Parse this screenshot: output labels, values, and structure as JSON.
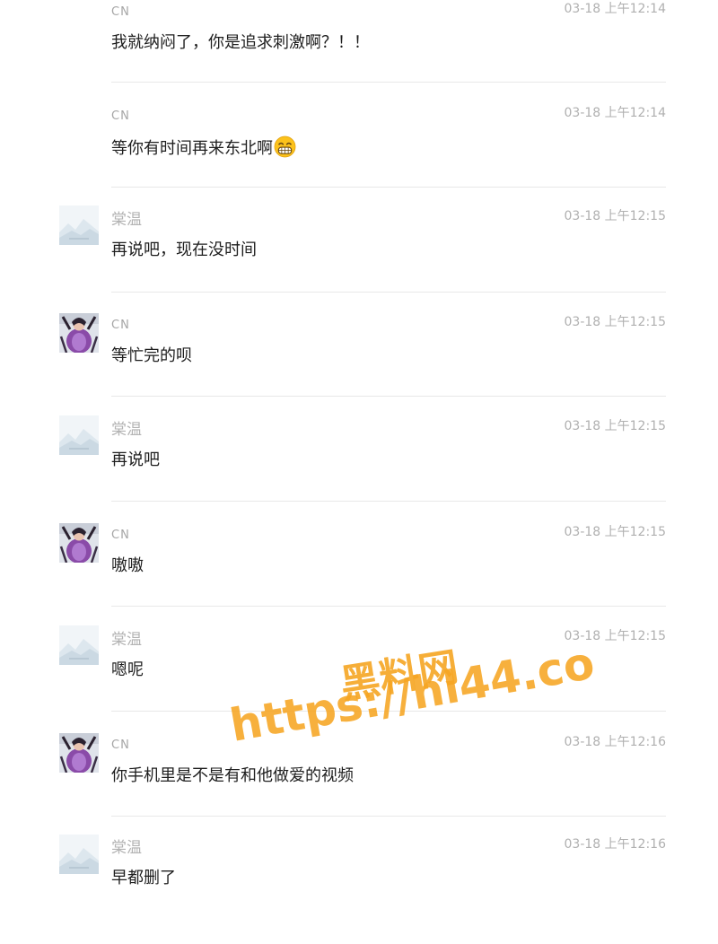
{
  "messages": [
    {
      "sender": "CN",
      "avatar": "purple-portrait-avatar",
      "show_avatar": false,
      "time": "03-18 上午12:14",
      "text": "我就纳闷了，你是追求刺激啊？！！"
    },
    {
      "sender": "CN",
      "avatar": "purple-portrait-avatar",
      "show_avatar": false,
      "time": "03-18 上午12:14",
      "text": "等你有时间再来东北啊",
      "emoji": "grinning-face-emoji"
    },
    {
      "sender": "棠温",
      "avatar": "landscape-placeholder-avatar",
      "show_avatar": true,
      "time": "03-18 上午12:15",
      "text": "再说吧，现在没时间"
    },
    {
      "sender": "CN",
      "avatar": "purple-portrait-avatar",
      "show_avatar": true,
      "time": "03-18 上午12:15",
      "text": "等忙完的呗"
    },
    {
      "sender": "棠温",
      "avatar": "landscape-placeholder-avatar",
      "show_avatar": true,
      "time": "03-18 上午12:15",
      "text": "再说吧"
    },
    {
      "sender": "CN",
      "avatar": "purple-portrait-avatar",
      "show_avatar": true,
      "time": "03-18 上午12:15",
      "text": "嗷嗷"
    },
    {
      "sender": "棠温",
      "avatar": "landscape-placeholder-avatar",
      "show_avatar": true,
      "time": "03-18 上午12:15",
      "text": "嗯呢"
    },
    {
      "sender": "CN",
      "avatar": "purple-portrait-avatar",
      "show_avatar": true,
      "time": "03-18 上午12:16",
      "text": "你手机里是不是有和他做爱的视频"
    },
    {
      "sender": "棠温",
      "avatar": "landscape-placeholder-avatar",
      "show_avatar": true,
      "time": "03-18 上午12:16",
      "text": "早都删了"
    }
  ],
  "watermark": {
    "title": "黑料网",
    "url": "https://hl44.co",
    "color": "#f6a623"
  },
  "colors": {
    "name": "#a6a6a6",
    "time": "#b0b0b0",
    "text": "#1e1e1e",
    "divider": "#e8e8e8"
  }
}
